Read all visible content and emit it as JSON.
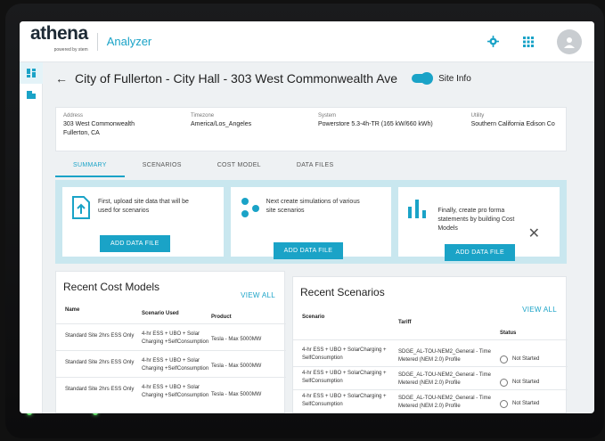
{
  "header": {
    "brand": "athena",
    "brand_sub": "powered by stem",
    "app_name": "Analyzer",
    "icons": [
      "gear-icon",
      "apps-grid-icon",
      "user-avatar-icon"
    ]
  },
  "rail": {
    "items": [
      {
        "icon": "dashboard-icon",
        "active": true
      },
      {
        "icon": "building-icon",
        "active": false
      }
    ]
  },
  "page": {
    "title": "City of Fullerton - City Hall - 303 West Commonwealth Ave",
    "toggle_label": "Site Info"
  },
  "site_info": {
    "address_label": "Address",
    "address_line1": "303 West Commonwealth",
    "address_line2": "Fullerton, CA",
    "timezone_label": "Timezone",
    "timezone": "America/Los_Angeles",
    "system_label": "System",
    "system": "Powerstore 5.3-4h-TR  (165 kW/660 kWh)",
    "utility_label": "Utility",
    "utility": "Southern California Edison Co"
  },
  "tabs": [
    {
      "label": "SUMMARY",
      "active": true
    },
    {
      "label": "SCENARIOS",
      "active": false
    },
    {
      "label": "COST MODEL",
      "active": false
    },
    {
      "label": "DATA FILES",
      "active": false
    }
  ],
  "steps": [
    {
      "text": "First, upload site data that will be used for scenarios",
      "button": "ADD DATA FILE",
      "icon": "upload-file-icon"
    },
    {
      "text": "Next create simulations of various site scenarios",
      "button": "ADD DATA FILE",
      "icon": "scenario-nodes-icon"
    },
    {
      "text": "Finally, create pro forma statements by building Cost Models",
      "button": "ADD DATA FILE",
      "icon": "bar-chart-icon"
    }
  ],
  "cost_models": {
    "title": "Recent Cost Models",
    "view_all": "VIEW ALL",
    "columns": [
      "Name",
      "Scenario Used",
      "Product"
    ],
    "rows": [
      {
        "name": "Standard Site 2hrs ESS Only",
        "scenario": "4-hr ESS + UBO + Solar Charging +SelfConsumption",
        "product": "Tesla - Max 5000MW"
      },
      {
        "name": "Standard Site 2hrs ESS Only",
        "scenario": "4-hr ESS + UBO + Solar Charging +SelfConsumption",
        "product": "Tesla - Max 5000MW"
      },
      {
        "name": "Standard Site 2hrs ESS Only",
        "scenario": "4-hr ESS + UBO + Solar Charging +SelfConsumption",
        "product": "Tesla - Max 5000MW"
      }
    ]
  },
  "scenarios": {
    "title": "Recent Scenarios",
    "view_all": "VIEW ALL",
    "columns": [
      "Scenario",
      "Tariff",
      "Status"
    ],
    "rows": [
      {
        "scenario": "4-hr ESS + UBO + SolarCharging + SelfConsumption",
        "tariff": "SDGE_AL-TOU-NEM2_General - Time Metered (NEM 2.0) Profile",
        "status": "Not Started"
      },
      {
        "scenario": "4-hr ESS + UBO + SolarCharging + SelfConsumption",
        "tariff": "SDGE_AL-TOU-NEM2_General - Time Metered (NEM 2.0) Profile",
        "status": "Not Started"
      },
      {
        "scenario": "4-hr ESS + UBO + SolarCharging + SelfConsumption",
        "tariff": "SDGE_AL-TOU-NEM2_General - Time Metered (NEM 2.0) Profile",
        "status": "Not Started"
      }
    ]
  },
  "colors": {
    "accent": "#1aa3c7",
    "banner": "#c9e7ef"
  }
}
